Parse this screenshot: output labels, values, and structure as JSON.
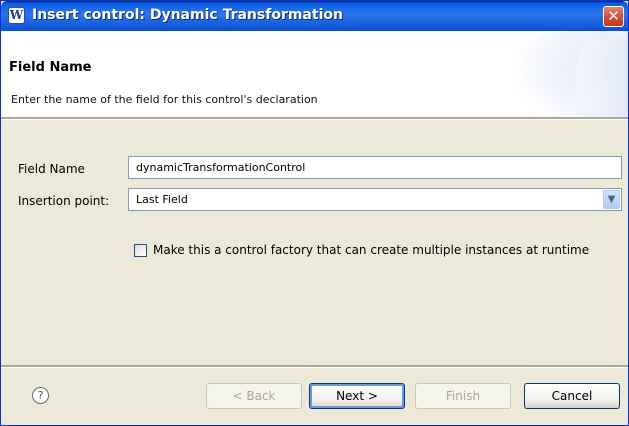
{
  "window": {
    "title": "Insert control: Dynamic Transformation",
    "app_icon": "W",
    "close_glyph": "✕"
  },
  "banner": {
    "title": "Field Name",
    "description": "Enter the name of the field for this control's declaration"
  },
  "form": {
    "field_name_label": "Field Name",
    "field_name_value": "dynamicTransformationControl",
    "insertion_point_label": "Insertion point:",
    "insertion_point_value": "Last Field",
    "dropdown_glyph": "▼",
    "factory_checkbox_label": "Make this a control factory that can create multiple instances at runtime",
    "factory_checked": false
  },
  "footer": {
    "help_glyph": "?",
    "back_label": "< Back",
    "next_label": "Next >",
    "finish_label": "Finish",
    "cancel_label": "Cancel"
  },
  "colors": {
    "titlebar": "#0a5ee4",
    "dialog_background": "#ece9d8",
    "close_button": "#d2472a"
  },
  "icons": {
    "app": "weblogic-icon",
    "close": "close-icon",
    "dropdown": "chevron-down-icon",
    "help": "help-icon"
  }
}
